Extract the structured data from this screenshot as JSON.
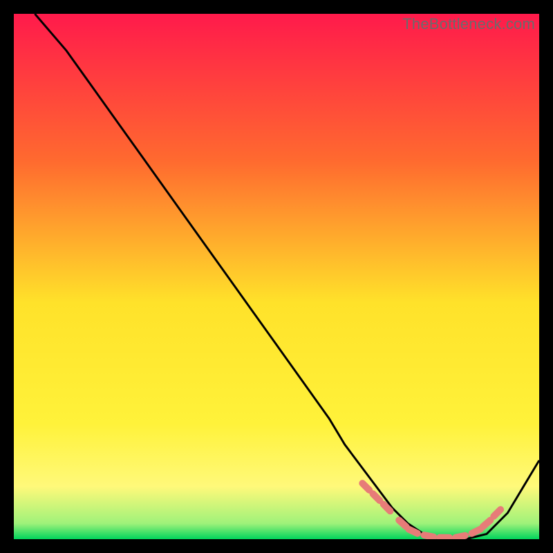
{
  "watermark": "TheBottleneck.com",
  "chart_data": {
    "type": "line",
    "title": "",
    "xlabel": "",
    "ylabel": "",
    "xlim": [
      0,
      100
    ],
    "ylim": [
      0,
      100
    ],
    "gradient_colors": {
      "top": "#ff1a4b",
      "upper_mid": "#ff8a2a",
      "mid": "#ffe22a",
      "lower_mid": "#fff97a",
      "bottom": "#00d45c"
    },
    "series": [
      {
        "name": "bottleneck-curve",
        "x": [
          4,
          10,
          15,
          20,
          25,
          30,
          35,
          40,
          45,
          50,
          55,
          60,
          63,
          66,
          69,
          72,
          75,
          78,
          82,
          86,
          90,
          94,
          100
        ],
        "y": [
          100,
          93,
          86,
          79,
          72,
          65,
          58,
          51,
          44,
          37,
          30,
          23,
          18,
          14,
          10,
          6,
          3,
          1,
          0,
          0,
          1,
          5,
          15
        ]
      }
    ],
    "accent_dots": {
      "name": "recommended-range",
      "color": "#e77c78",
      "points": [
        {
          "x": 67,
          "y": 10
        },
        {
          "x": 69,
          "y": 8
        },
        {
          "x": 71,
          "y": 6
        },
        {
          "x": 74,
          "y": 3
        },
        {
          "x": 76,
          "y": 1.5
        },
        {
          "x": 79,
          "y": 0.6
        },
        {
          "x": 82,
          "y": 0.3
        },
        {
          "x": 85,
          "y": 0.5
        },
        {
          "x": 88,
          "y": 1.5
        },
        {
          "x": 90,
          "y": 3
        },
        {
          "x": 92,
          "y": 5
        }
      ]
    }
  }
}
